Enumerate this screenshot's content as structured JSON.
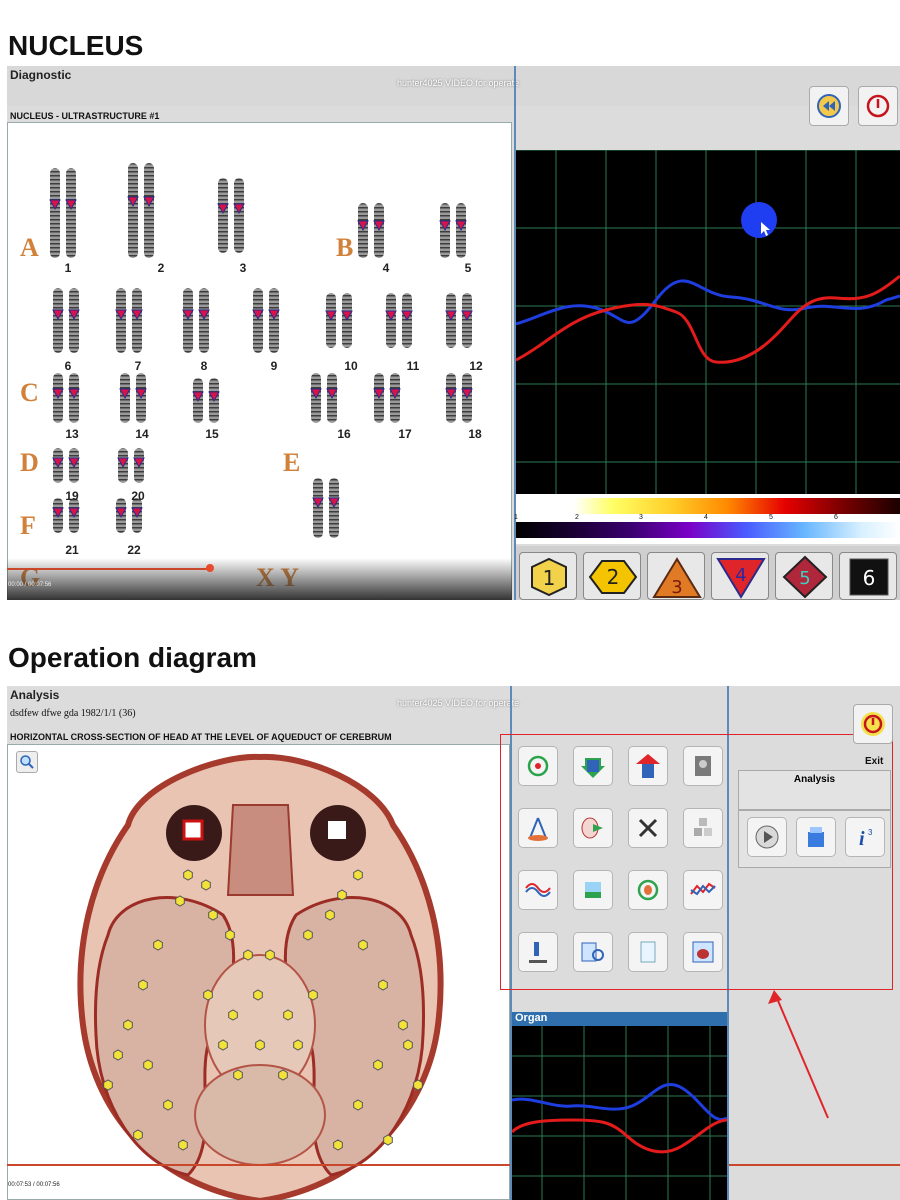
{
  "section1": {
    "heading": "NUCLEUS",
    "window_title": "Diagnostic",
    "video_label": "hunter4025 VIDEO for operate",
    "panel_title": "NUCLEUS - ULTRASTRUCTURE #1",
    "time": "00:00 / 00:07:56",
    "groups": [
      {
        "letter": "A",
        "numbers": [
          "1",
          "2",
          "3"
        ]
      },
      {
        "letter": "B",
        "numbers": [
          "4",
          "5"
        ]
      },
      {
        "letter": "C",
        "numbers": [
          "6",
          "7",
          "8",
          "9",
          "10",
          "11",
          "12"
        ]
      },
      {
        "letter": "D",
        "numbers": [
          "13",
          "14",
          "15"
        ]
      },
      {
        "letter": "E",
        "numbers": [
          "16",
          "17",
          "18"
        ]
      },
      {
        "letter": "F",
        "numbers": [
          "19",
          "20"
        ]
      },
      {
        "letter": "G",
        "numbers": [
          "21",
          "22"
        ]
      },
      {
        "letter": "X Y",
        "numbers": []
      }
    ],
    "spectrum_ticks": [
      "1",
      "2",
      "3",
      "4",
      "5",
      "6"
    ],
    "shape_buttons": [
      "1",
      "2",
      "3",
      "4",
      "5",
      "6"
    ],
    "buttons": {
      "refresh_icon": "refresh-icon",
      "power_icon": "power-icon"
    }
  },
  "section2": {
    "heading": "Operation diagram",
    "window_title": "Analysis",
    "patient_line": "dsdfew dfwe gda  1982/1/1 (36)",
    "video_label": "hunter4025 VIDEO for operate",
    "panel_title": "HORIZONTAL CROSS-SECTION OF HEAD AT THE LEVEL OF AQUEDUCT OF CEREBRUM",
    "exit_label": "Exit",
    "analysis_label": "Analysis",
    "organ_label": "Organ",
    "time": "00:07:53 / 00:07:56",
    "tools": [
      "target-icon",
      "arrow-down-icon",
      "arrow-up-icon",
      "grinder-icon",
      "compass-icon",
      "organ-arrow-icon",
      "close-icon",
      "cubes-icon",
      "wave-search-icon",
      "flask-icon",
      "organ-cycle-icon",
      "chart-lines-icon",
      "microscope-icon",
      "book-search-icon",
      "document-icon",
      "organ-scan-icon"
    ],
    "analysis_buttons": [
      "play-icon",
      "box-icon",
      "info-icon"
    ]
  },
  "colors": {
    "group_letter": "#d1813a",
    "graph_bg": "#000000",
    "line_red": "#e31b1b",
    "line_blue": "#1f3ee0",
    "grid": "#2e8b57",
    "highlight_red": "#e0252a"
  }
}
